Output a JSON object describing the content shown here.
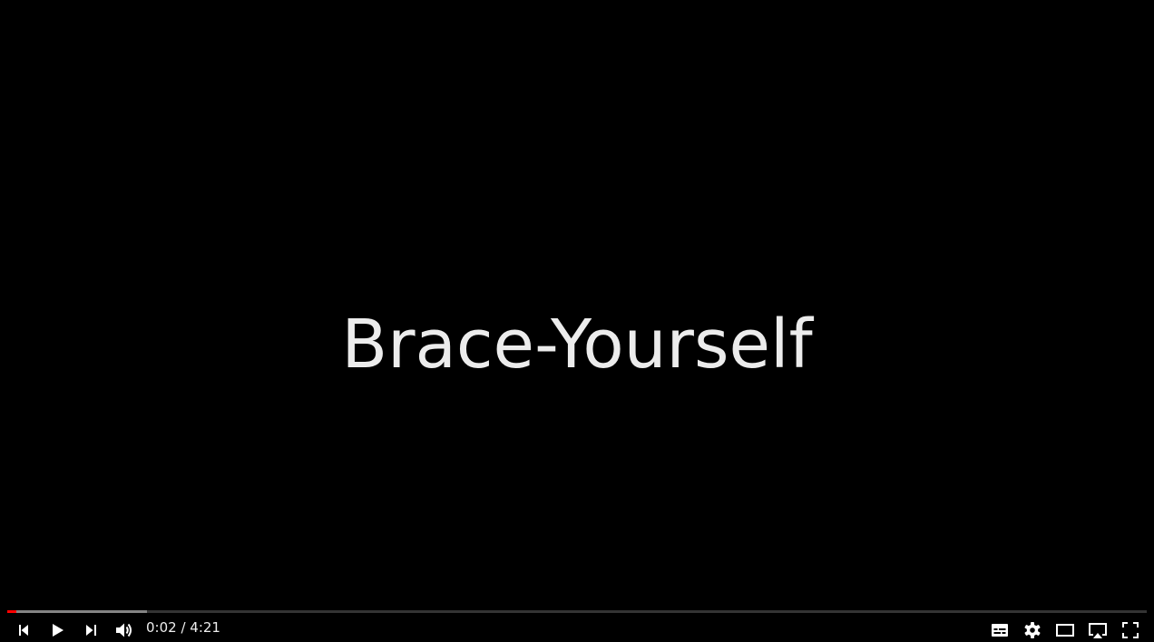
{
  "video": {
    "frame_text": "Brace-Yourself"
  },
  "progress": {
    "played_fraction": 0.0077,
    "buffered_fraction": 0.123,
    "played_color": "#ff0000"
  },
  "time": {
    "current": "0:02",
    "separator": " / ",
    "duration": "4:21"
  },
  "controls": {
    "left": [
      "previous-icon",
      "play-icon",
      "next-icon",
      "volume-icon"
    ],
    "right": [
      "subtitles-icon",
      "gear-icon",
      "theater-mode-icon",
      "cast-icon",
      "fullscreen-icon"
    ]
  }
}
